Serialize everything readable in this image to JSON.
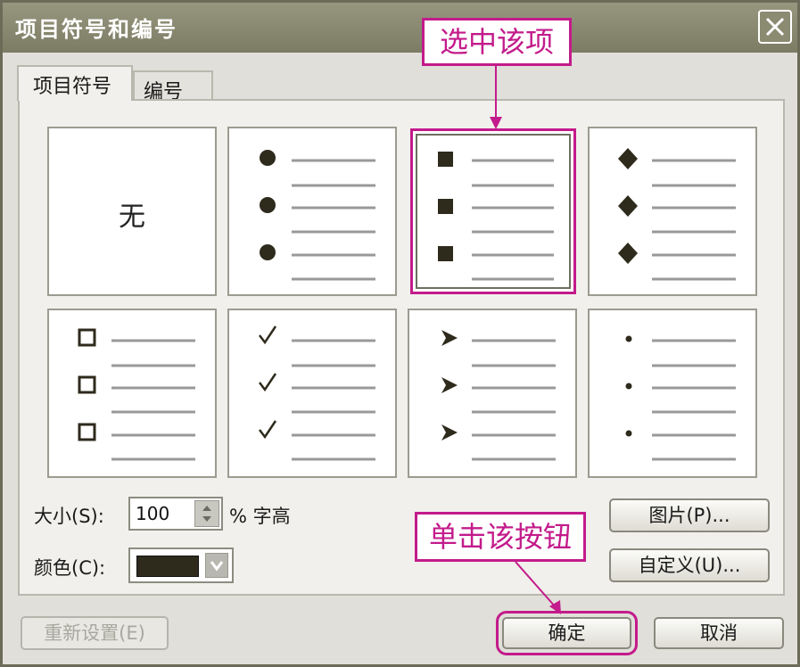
{
  "dialog": {
    "title": "项目符号和编号",
    "close_label": "×"
  },
  "tabs": [
    {
      "label": "项目符号"
    },
    {
      "label": "编号"
    }
  ],
  "bullets": {
    "none_label": "无"
  },
  "size": {
    "label": "大小(S):",
    "value": "100",
    "suffix": "% 字高"
  },
  "color": {
    "label": "颜色(C):",
    "value": "#2e2a1c"
  },
  "buttons": {
    "picture": "图片(P)...",
    "customize": "自定义(U)...",
    "reset": "重新设置(E)",
    "ok": "确定",
    "cancel": "取消"
  },
  "annotations": {
    "select_item": "选中该项",
    "click_button": "单击该按钮"
  },
  "colors": {
    "accent": "#c31b8b",
    "titlebar": "#8b8b72",
    "dialog_bg": "#e1dfd9"
  }
}
